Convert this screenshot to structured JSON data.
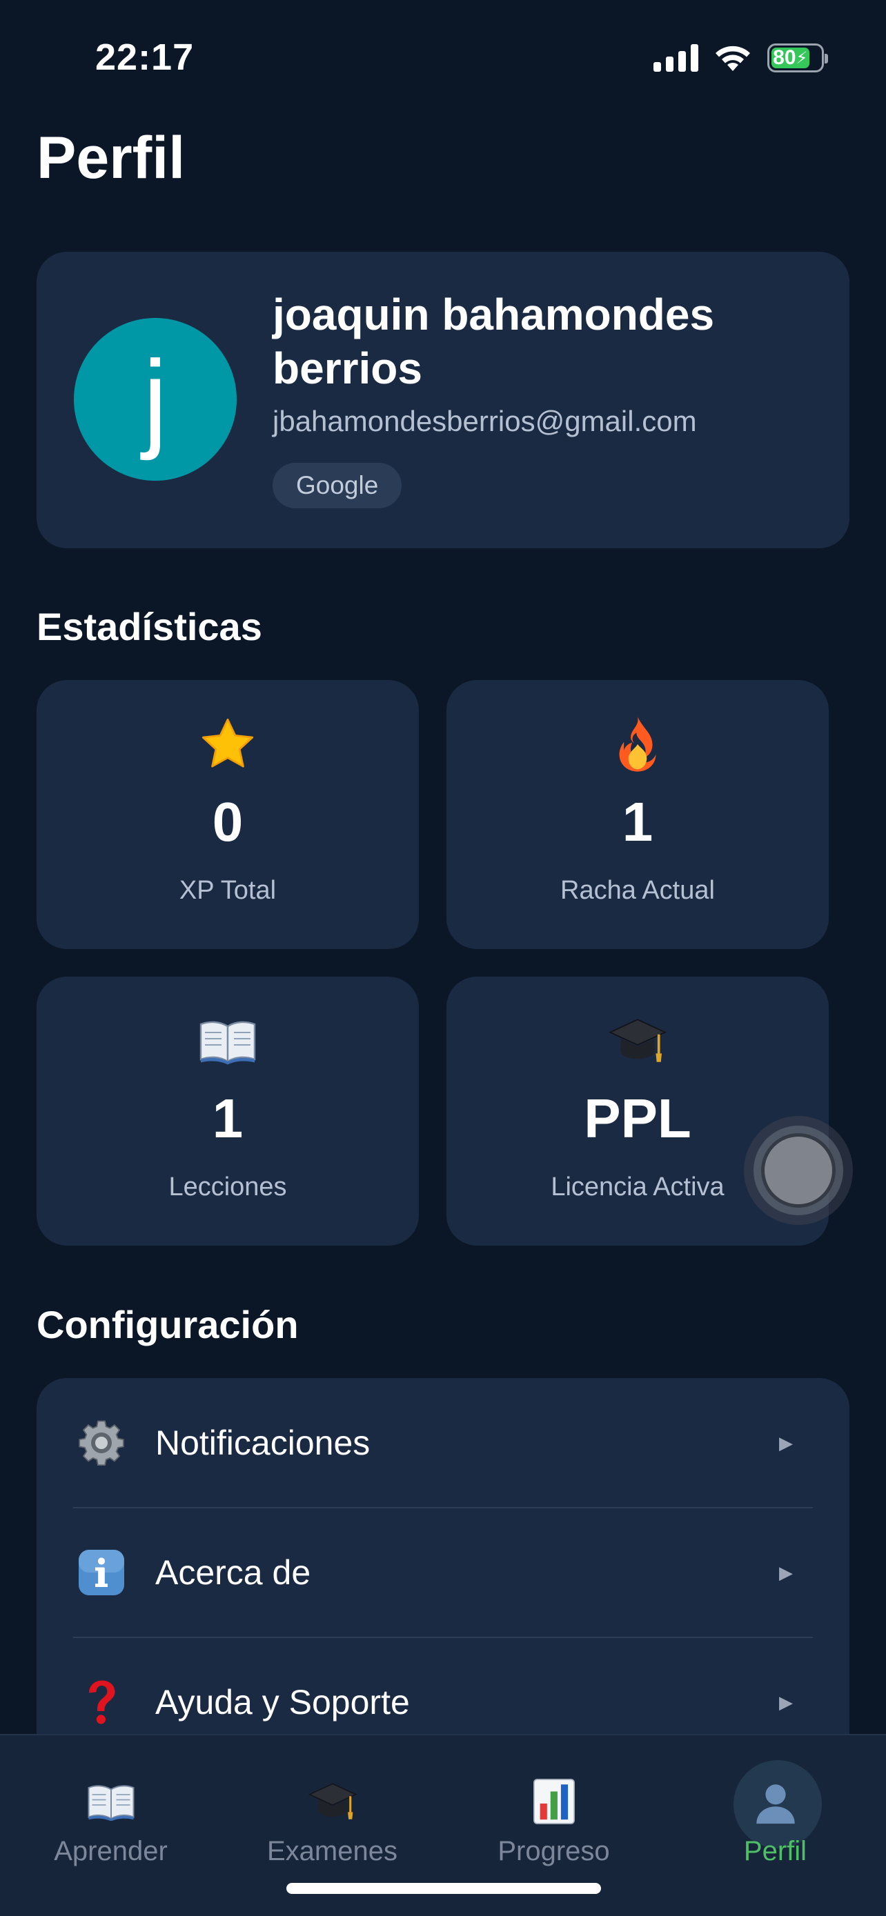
{
  "status_bar": {
    "time": "22:17",
    "battery": "80"
  },
  "page_title": "Perfil",
  "profile": {
    "avatar_initial": "j",
    "name": "joaquin bahamondes berrios",
    "email": "jbahamondesberrios@gmail.com",
    "provider": "Google"
  },
  "stats_title": "Estadísticas",
  "stats": [
    {
      "value": "0",
      "label": "XP Total",
      "icon": "star-icon"
    },
    {
      "value": "1",
      "label": "Racha Actual",
      "icon": "fire-icon"
    },
    {
      "value": "1",
      "label": "Lecciones",
      "icon": "open-book-icon"
    },
    {
      "value": "PPL",
      "label": "Licencia Activa",
      "icon": "graduation-cap-icon"
    }
  ],
  "settings_title": "Configuración",
  "settings": [
    {
      "label": "Notificaciones",
      "icon": "gear-icon"
    },
    {
      "label": "Acerca de",
      "icon": "info-icon"
    },
    {
      "label": "Ayuda y Soporte",
      "icon": "question-mark-icon"
    }
  ],
  "tabs": [
    {
      "label": "Aprender",
      "icon": "open-book-icon"
    },
    {
      "label": "Examenes",
      "icon": "graduation-cap-icon"
    },
    {
      "label": "Progreso",
      "icon": "bar-chart-icon"
    },
    {
      "label": "Perfil",
      "icon": "person-icon",
      "active": true
    }
  ],
  "colors": {
    "background": "#0b1626",
    "card": "#1b2a43",
    "avatar": "#0098a6",
    "active_tab": "#4fbf66",
    "battery": "#35c759"
  }
}
